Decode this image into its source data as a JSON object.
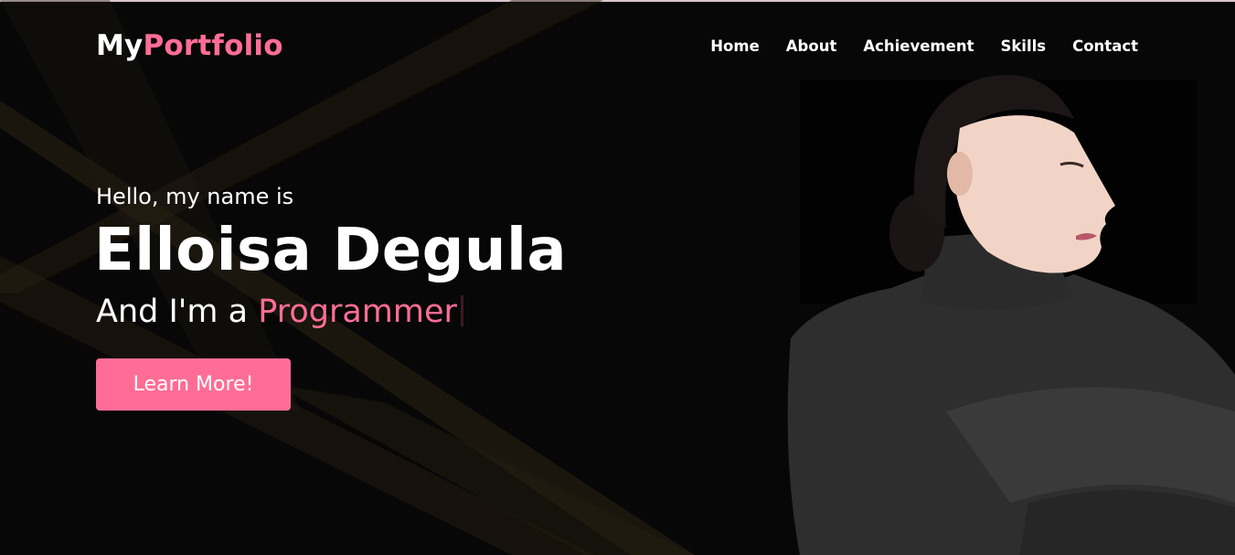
{
  "header": {
    "logo_prefix": "My",
    "logo_accent": "Portfolio",
    "nav": [
      {
        "label": "Home"
      },
      {
        "label": "About"
      },
      {
        "label": "Achievement"
      },
      {
        "label": "Skills"
      },
      {
        "label": "Contact"
      }
    ]
  },
  "hero": {
    "greeting": "Hello, my name is",
    "name": "Elloisa Degula",
    "role_prefix": "And I'm a ",
    "role_typed": "Programmer",
    "cta_label": "Learn More!"
  },
  "colors": {
    "accent": "#ff6d96",
    "background": "#070707",
    "text": "#ffffff",
    "light_rays": "#2a2110"
  },
  "icons": {
    "portrait": "person-portrait-photo"
  }
}
